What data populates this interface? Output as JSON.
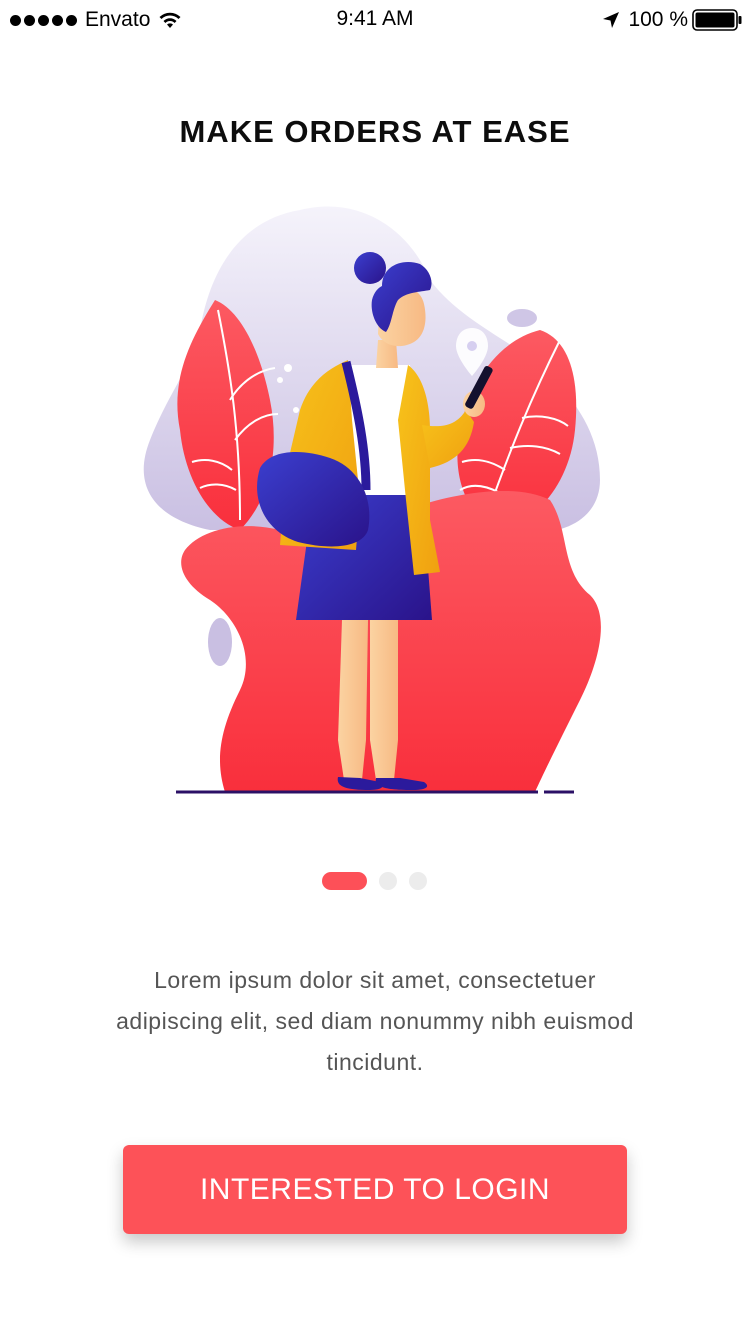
{
  "status_bar": {
    "carrier": "Envato",
    "time": "9:41 AM",
    "battery": "100 %",
    "icons": [
      "signal-dots-icon",
      "wifi-icon",
      "location-arrow-icon",
      "battery-icon"
    ]
  },
  "onboarding": {
    "title": "MAKE ORDERS AT EASE",
    "illustration": "woman-holding-phone-illustration",
    "pager": {
      "total_pages": 3,
      "current_page": 1,
      "active_color": "#fd5058",
      "inactive_color": "#ececec"
    },
    "description": "Lorem ipsum dolor sit amet, consectetuer adipiscing elit, sed diam nonummy nibh euismod tincidunt.",
    "button_label": "INTERESTED TO LOGIN"
  },
  "colors": {
    "accent": "#fd5258",
    "title_text": "#0d0d0d",
    "body_text": "#555555",
    "background": "#ffffff"
  }
}
